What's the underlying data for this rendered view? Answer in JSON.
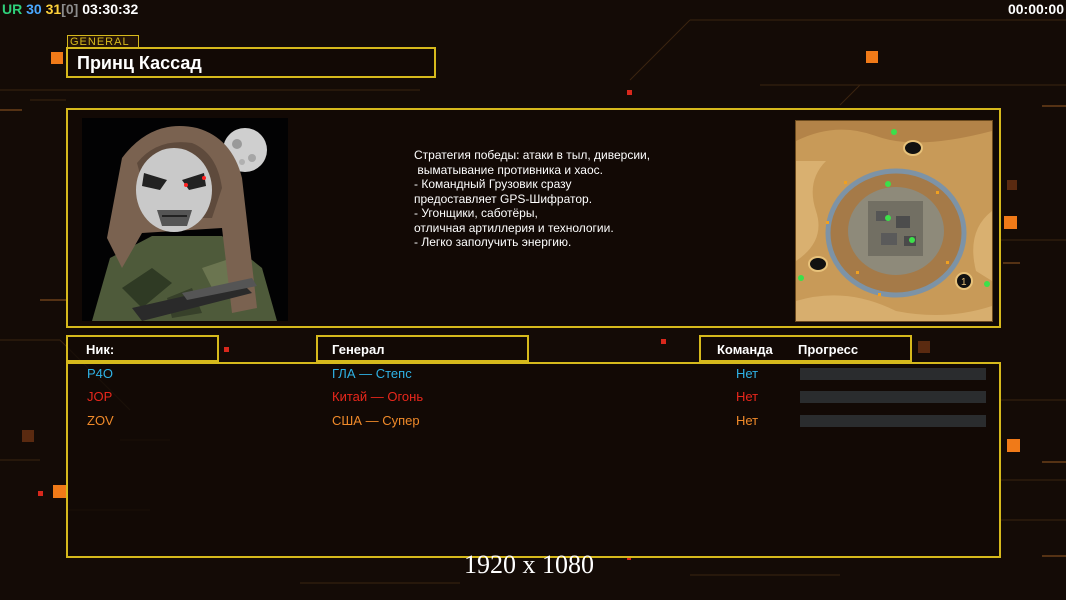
{
  "hud": {
    "ur_label": "UR",
    "fps": "30",
    "limit": "31",
    "dropped": "[0]",
    "clock": "03:30:32",
    "timer": "00:00:00"
  },
  "general": {
    "tag": "GENERAL",
    "name": "Принц Кассад"
  },
  "strategy_lines": [
    "Стратегия победы: атаки в тыл, диверсии,",
    " выматывание противника и хаос.",
    "",
    "- Командный Грузовик сразу",
    "предоставляет GPS-Шифратор.",
    "",
    "- Угонщики, саботёры,",
    "отличная артиллерия и технологии.",
    "",
    "- Легко заполучить энергию."
  ],
  "headers": {
    "nick": "Ник:",
    "general": "Генерал",
    "team": "Команда",
    "progress": "Прогресс"
  },
  "players": [
    {
      "nick": "P4O",
      "general": "ГЛА — Степс",
      "team": "Нет",
      "progress": 0,
      "color": "#2fb2e6"
    },
    {
      "nick": "JOP",
      "general": "Китай — Огонь",
      "team": "Нет",
      "progress": 0,
      "color": "#e8271c"
    },
    {
      "nick": "ZOV",
      "general": "США — Супер",
      "team": "Нет",
      "progress": 0,
      "color": "#f08a2a"
    }
  ],
  "resolution": "1920 x 1080",
  "colors": {
    "accent": "#d6b91c",
    "hud_ur": "#2fd07a",
    "hud_fps": "#4aa8ff",
    "hud_limit": "#ffd23a",
    "hud_dropped": "#8c8c8c"
  }
}
